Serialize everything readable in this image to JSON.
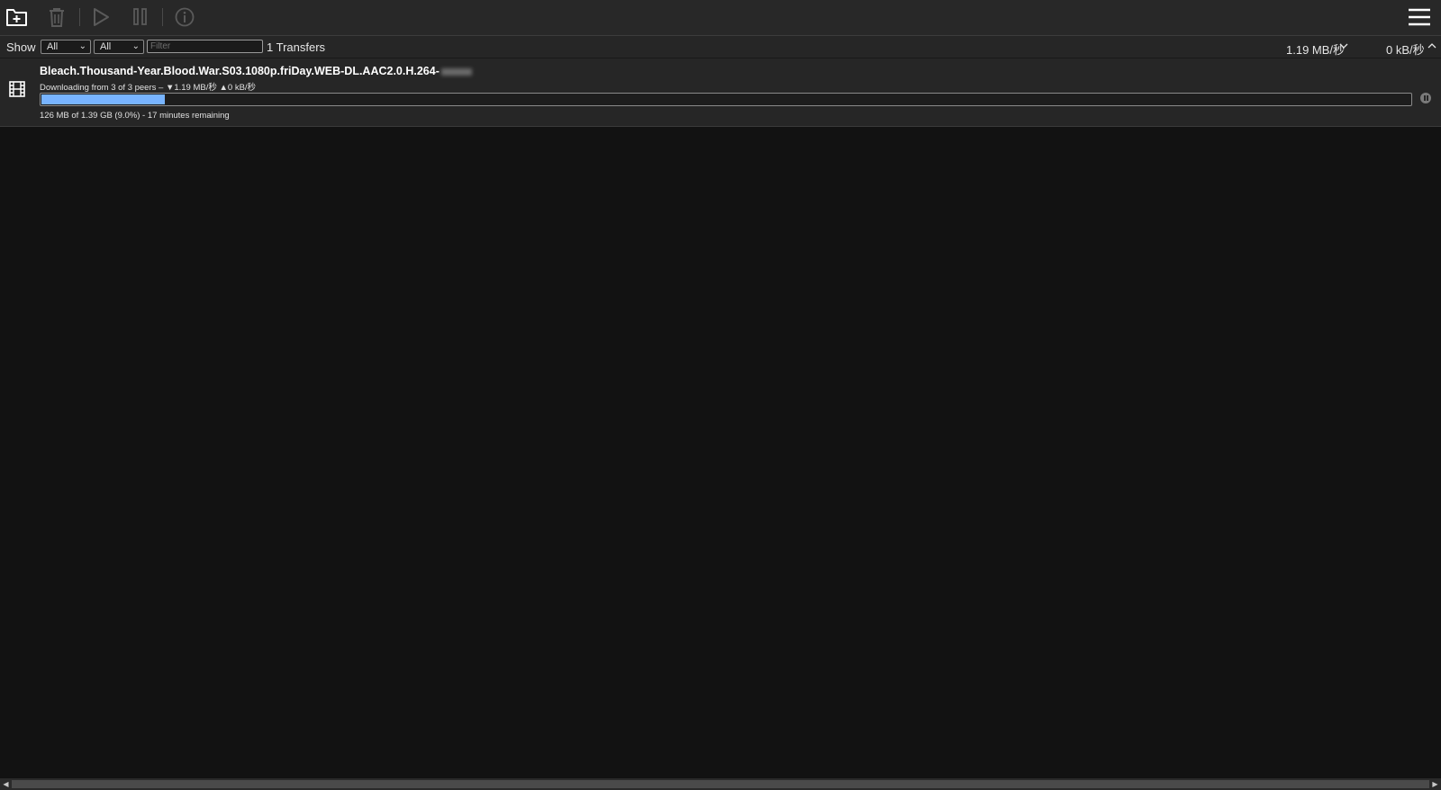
{
  "toolbar": {
    "open_icon": "folder-add-icon",
    "remove_icon": "trash-icon",
    "start_icon": "play-icon",
    "pause_icon": "pause-icon",
    "inspector_icon": "info-icon",
    "menu_icon": "hamburger-menu-icon"
  },
  "filterbar": {
    "show_label": "Show",
    "status_filter": "All",
    "tracker_filter": "All",
    "filter_placeholder": "Filter",
    "transfer_count": "1 Transfers",
    "download_speed": "1.19 MB/秒",
    "upload_speed": "0 kB/秒"
  },
  "torrents": [
    {
      "name": "Bleach.Thousand-Year.Blood.War.S03.1080p.friDay.WEB-DL.AAC2.0.H.264-",
      "peers": "Downloading from 3 of 3 peers – ▼1.19 MB/秒 ▲0 kB/秒",
      "progress_text": "126 MB of 1.39 GB (9.0%) - 17 minutes remaining",
      "percent_done": 9.0,
      "type_icon": "film-icon"
    }
  ],
  "colors": {
    "background": "#121212",
    "toolbar": "#282828",
    "progress_fill": "#78b4ff"
  }
}
